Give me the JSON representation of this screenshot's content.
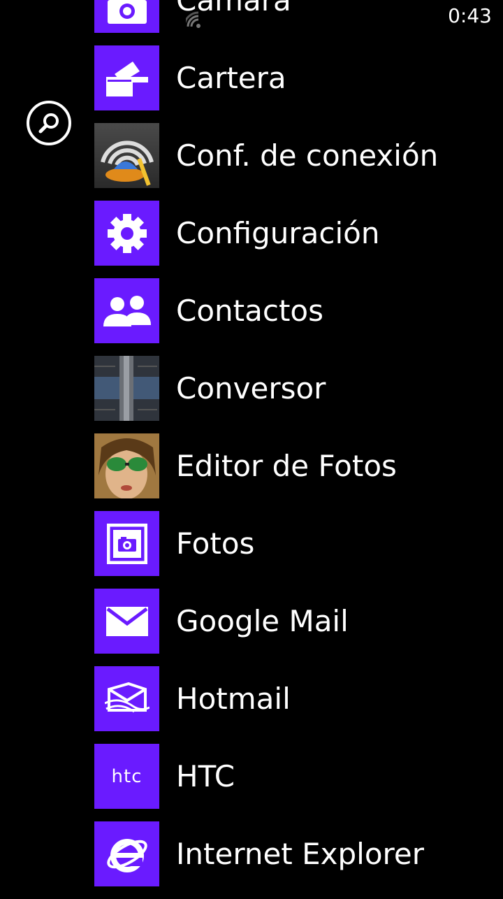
{
  "status_bar": {
    "time": "0:43",
    "signal_icon": "wifi-signal-icon"
  },
  "search": {
    "icon": "search-icon"
  },
  "colors": {
    "accent": "#6a1bff",
    "background": "#000000",
    "text": "#ffffff"
  },
  "apps": [
    {
      "label": "Cámara",
      "icon": "camera-icon"
    },
    {
      "label": "Cartera",
      "icon": "wallet-icon"
    },
    {
      "label": "Conf. de conexión",
      "icon": "connection-settings-icon"
    },
    {
      "label": "Configuración",
      "icon": "gear-icon"
    },
    {
      "label": "Contactos",
      "icon": "contacts-icon"
    },
    {
      "label": "Conversor",
      "icon": "converter-icon"
    },
    {
      "label": "Editor de Fotos",
      "icon": "photo-editor-icon"
    },
    {
      "label": "Fotos",
      "icon": "photos-icon"
    },
    {
      "label": "Google Mail",
      "icon": "mail-icon"
    },
    {
      "label": "Hotmail",
      "icon": "hotmail-icon"
    },
    {
      "label": "HTC",
      "icon": "htc-logo-icon",
      "tile_text": "htc"
    },
    {
      "label": "Internet Explorer",
      "icon": "internet-explorer-icon"
    }
  ]
}
